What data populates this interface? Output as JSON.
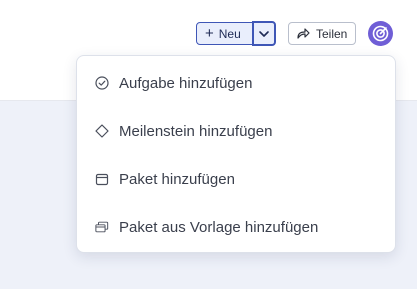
{
  "toolbar": {
    "new_label": "Neu",
    "share_label": "Teilen"
  },
  "menu": {
    "items": [
      {
        "label": "Aufgabe hinzufügen",
        "icon": "check-circle-icon"
      },
      {
        "label": "Meilenstein hinzufügen",
        "icon": "diamond-icon"
      },
      {
        "label": "Paket hinzufügen",
        "icon": "package-icon"
      },
      {
        "label": "Paket aus Vorlage hinzufügen",
        "icon": "template-package-icon"
      }
    ]
  },
  "colors": {
    "accent": "#3e56b6",
    "avatar": "#6f5ed6",
    "background": "#eef1f9"
  }
}
